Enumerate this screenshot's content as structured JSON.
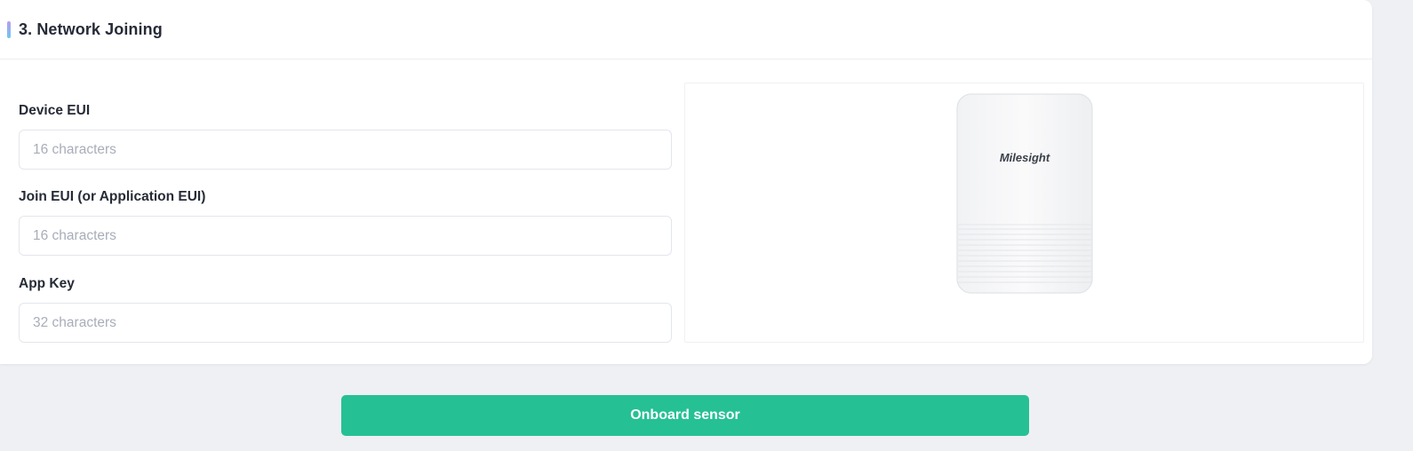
{
  "section": {
    "title": "3. Network Joining"
  },
  "fields": [
    {
      "label": "Device EUI",
      "placeholder": "16 characters",
      "value": ""
    },
    {
      "label": "Join EUI (or Application EUI)",
      "placeholder": "16 characters",
      "value": ""
    },
    {
      "label": "App Key",
      "placeholder": "32 characters",
      "value": ""
    }
  ],
  "device_image": {
    "brand": "Milesight",
    "icon": "sensor-device-image"
  },
  "action": {
    "label": "Onboard sensor"
  },
  "colors": {
    "accent_gradient_top": "#b89cf0",
    "accent_gradient_bottom": "#6fc6ee",
    "primary_button": "#26c095",
    "page_background": "#eef0f4"
  }
}
